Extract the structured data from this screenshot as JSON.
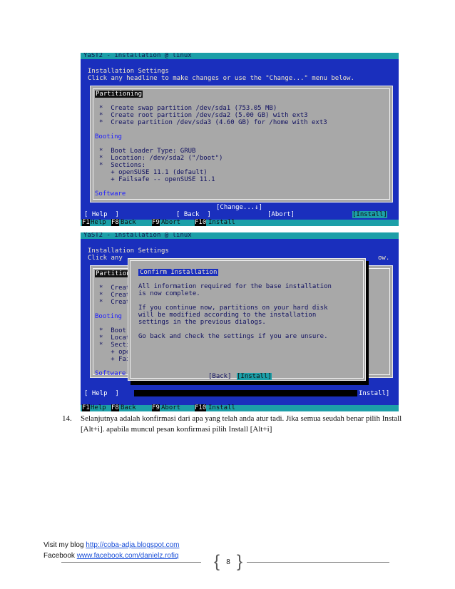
{
  "screen1": {
    "title": "YaST2 - installation @ linux",
    "heading": "Installation Settings",
    "subheading": "Click any headline to make changes or use the \"Change...\" menu below.",
    "sections": {
      "partitioning": "Partitioning",
      "part_lines": [
        "*  Create swap partition /dev/sda1 (753.05 MB)",
        "*  Create root partition /dev/sda2 (5.00 GB) with ext3",
        "*  Create partition /dev/sda3 (4.60 GB) for /home with ext3"
      ],
      "booting": "Booting",
      "boot_lines": [
        "*  Boot Loader Type: GRUB",
        "*  Location: /dev/sda2 (\"/boot\")",
        "*  Sections:",
        "   + openSUSE 11.1 (default)",
        "   + Failsafe -- openSUSE 11.1"
      ],
      "software": "Software"
    },
    "change_button": "[Change...↓]",
    "help_button": "[ Help  ]",
    "back_button": "[ Back  ]",
    "abort_button": "[Abort]",
    "install_button": "[Install]"
  },
  "screen2": {
    "title": "YaST2 - installation @ linux",
    "heading": "Installation Settings",
    "subheading": "Click any",
    "subheading_tail": "ow.",
    "partition_fragment": "Partition",
    "part_fragments": [
      "*  Creat",
      "*  Creat",
      "*  Creat"
    ],
    "booting": "Booting",
    "boot_fragments": [
      "*  Boot",
      "*  Locat",
      "*  Secti",
      "   + ope",
      "   + Fai"
    ],
    "software": "Software",
    "dialog": {
      "title": "Confirm Installation",
      "lines": [
        "All information required for the base installation",
        "is now complete.",
        "",
        "If you continue now, partitions on your hard disk",
        "will be modified according to the installation",
        "settings in the previous dialogs.",
        "",
        "Go back and check the settings if you are unsure."
      ],
      "back_button": "[Back]",
      "install_button": "[Install]"
    },
    "help_button": "[ Help  ]",
    "install_right": "Install]"
  },
  "fkeys": [
    {
      "key": "F1",
      "label": "Help"
    },
    {
      "key": "F8",
      "label": "Back"
    },
    {
      "key": "F9",
      "label": "Abort"
    },
    {
      "key": "F10",
      "label": "Install"
    }
  ],
  "caption": {
    "number": "14.",
    "text": "Selanjutnya adalah konfirmasi dari apa yang telah anda atur tadi. Jika semua seudah benar pilih Install [Alt+i]. apabila muncul pesan konfirmasi pilih Install [Alt+i]"
  },
  "footer": {
    "blog_label": "Visit my blog ",
    "blog_url": "http://coba-adja.blogspot.com",
    "fb_label": "Facebook ",
    "fb_url": "www.facebook.com/danielz.rofiq",
    "page_number": "8"
  },
  "colors": {
    "yast_blue": "#1a2fbd",
    "yast_teal": "#1c9fa8",
    "panel_gray": "#a8a8a8"
  }
}
